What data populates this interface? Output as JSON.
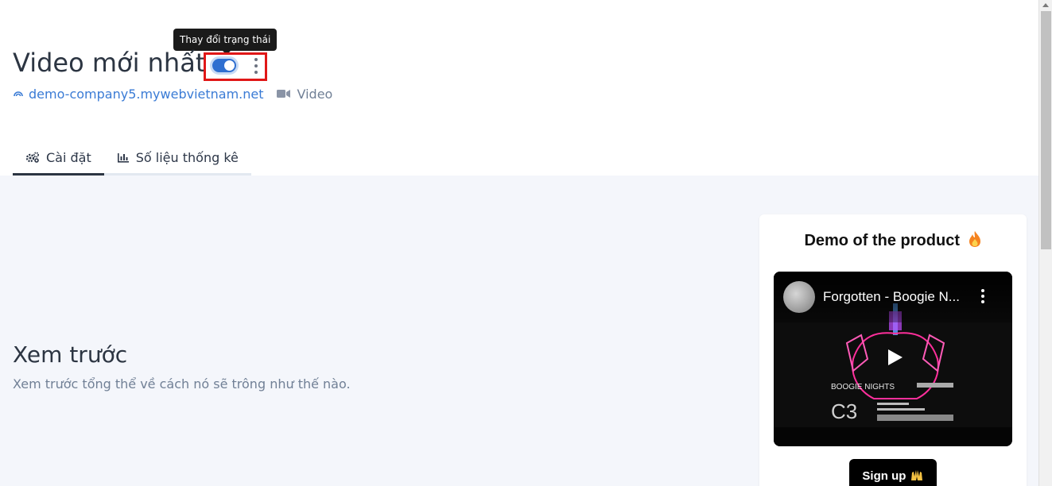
{
  "page": {
    "title": "Video mới nhất",
    "tooltip": "Thay đổi trạng thái",
    "toggle": {
      "state": "on",
      "accent": "#2f6fd0"
    },
    "site": {
      "icon": "site-icon",
      "domain": "demo-company5.mywebvietnam.net"
    },
    "type": {
      "icon": "video-camera-icon",
      "label": "Video"
    }
  },
  "tabs": [
    {
      "icon": "gears-icon",
      "label": "Cài đặt",
      "active": true
    },
    {
      "icon": "bar-chart-icon",
      "label": "Số liệu thống kê",
      "active": false
    }
  ],
  "preview": {
    "title": "Xem trước",
    "description": "Xem trước tổng thể về cách nó sẽ trông như thế nào."
  },
  "card": {
    "title": "Demo of the product",
    "title_icon": "fire-emoji",
    "video": {
      "title": "Forgotten - Boogie N...",
      "avatar_icon": "channel-avatar",
      "play_icon": "play-icon",
      "menu_icon": "more-vertical-icon"
    },
    "button_label": "Sign up",
    "button_icon": "raised-hands-emoji"
  }
}
